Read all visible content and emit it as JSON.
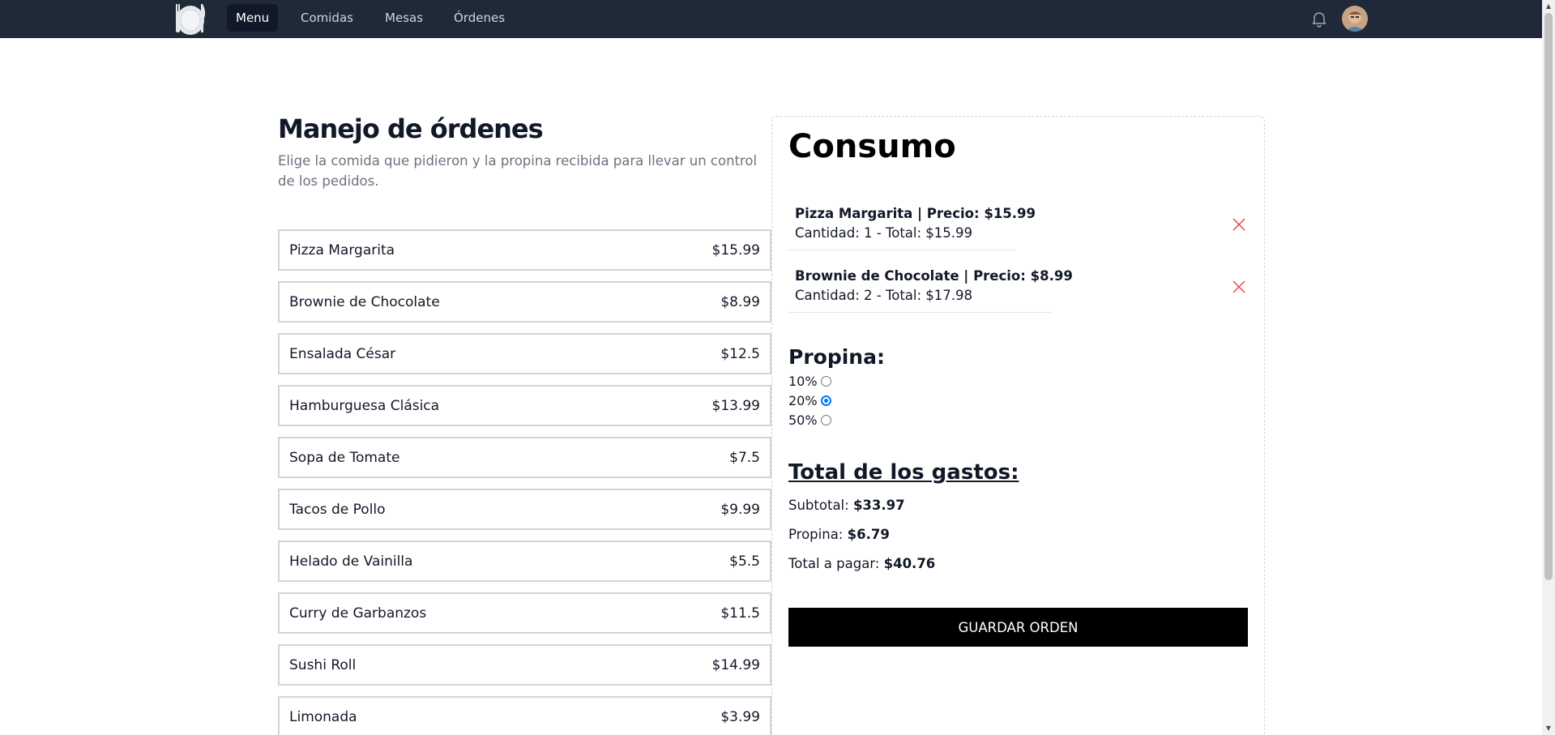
{
  "nav": {
    "logo_icon": "plate-fork-knife-icon",
    "links": [
      {
        "label": "Menu",
        "active": true
      },
      {
        "label": "Comidas",
        "active": false
      },
      {
        "label": "Mesas",
        "active": false
      },
      {
        "label": "Órdenes",
        "active": false
      }
    ],
    "bell_icon": "bell-icon",
    "avatar_icon": "user-avatar"
  },
  "page": {
    "title": "Manejo de órdenes",
    "subtitle": "Elige la comida que pidieron y la propina recibida para llevar un control de los pedidos."
  },
  "foods": [
    {
      "name": "Pizza Margarita",
      "price": "$15.99"
    },
    {
      "name": "Brownie de Chocolate",
      "price": "$8.99"
    },
    {
      "name": "Ensalada César",
      "price": "$12.5"
    },
    {
      "name": "Hamburguesa Clásica",
      "price": "$13.99"
    },
    {
      "name": "Sopa de Tomate",
      "price": "$7.5"
    },
    {
      "name": "Tacos de Pollo",
      "price": "$9.99"
    },
    {
      "name": "Helado de Vainilla",
      "price": "$5.5"
    },
    {
      "name": "Curry de Garbanzos",
      "price": "$11.5"
    },
    {
      "name": "Sushi Roll",
      "price": "$14.99"
    },
    {
      "name": "Limonada",
      "price": "$3.99"
    }
  ],
  "consumo": {
    "title": "Consumo",
    "items": [
      {
        "line1": "Pizza Margarita | Precio: $15.99",
        "line2": "Cantidad: 1 - Total: $15.99"
      },
      {
        "line1": "Brownie de Chocolate | Precio: $8.99",
        "line2": "Cantidad: 2 - Total: $17.98"
      }
    ],
    "propina_title": "Propina:",
    "tips": [
      {
        "label": "10%",
        "checked": false
      },
      {
        "label": "20%",
        "checked": true
      },
      {
        "label": "50%",
        "checked": false
      }
    ],
    "totals_title": "Total de los gastos:",
    "subtotal_label": "Subtotal:",
    "subtotal_value": "$33.97",
    "propina_label": "Propina:",
    "propina_value": "$6.79",
    "total_label": "Total a pagar:",
    "total_value": "$40.76",
    "save_label": "GUARDAR ORDEN"
  },
  "colors": {
    "navbar": "#1f2937",
    "remove_icon": "#ef4444",
    "radio_accent": "#0075ff",
    "button": "#000000"
  }
}
